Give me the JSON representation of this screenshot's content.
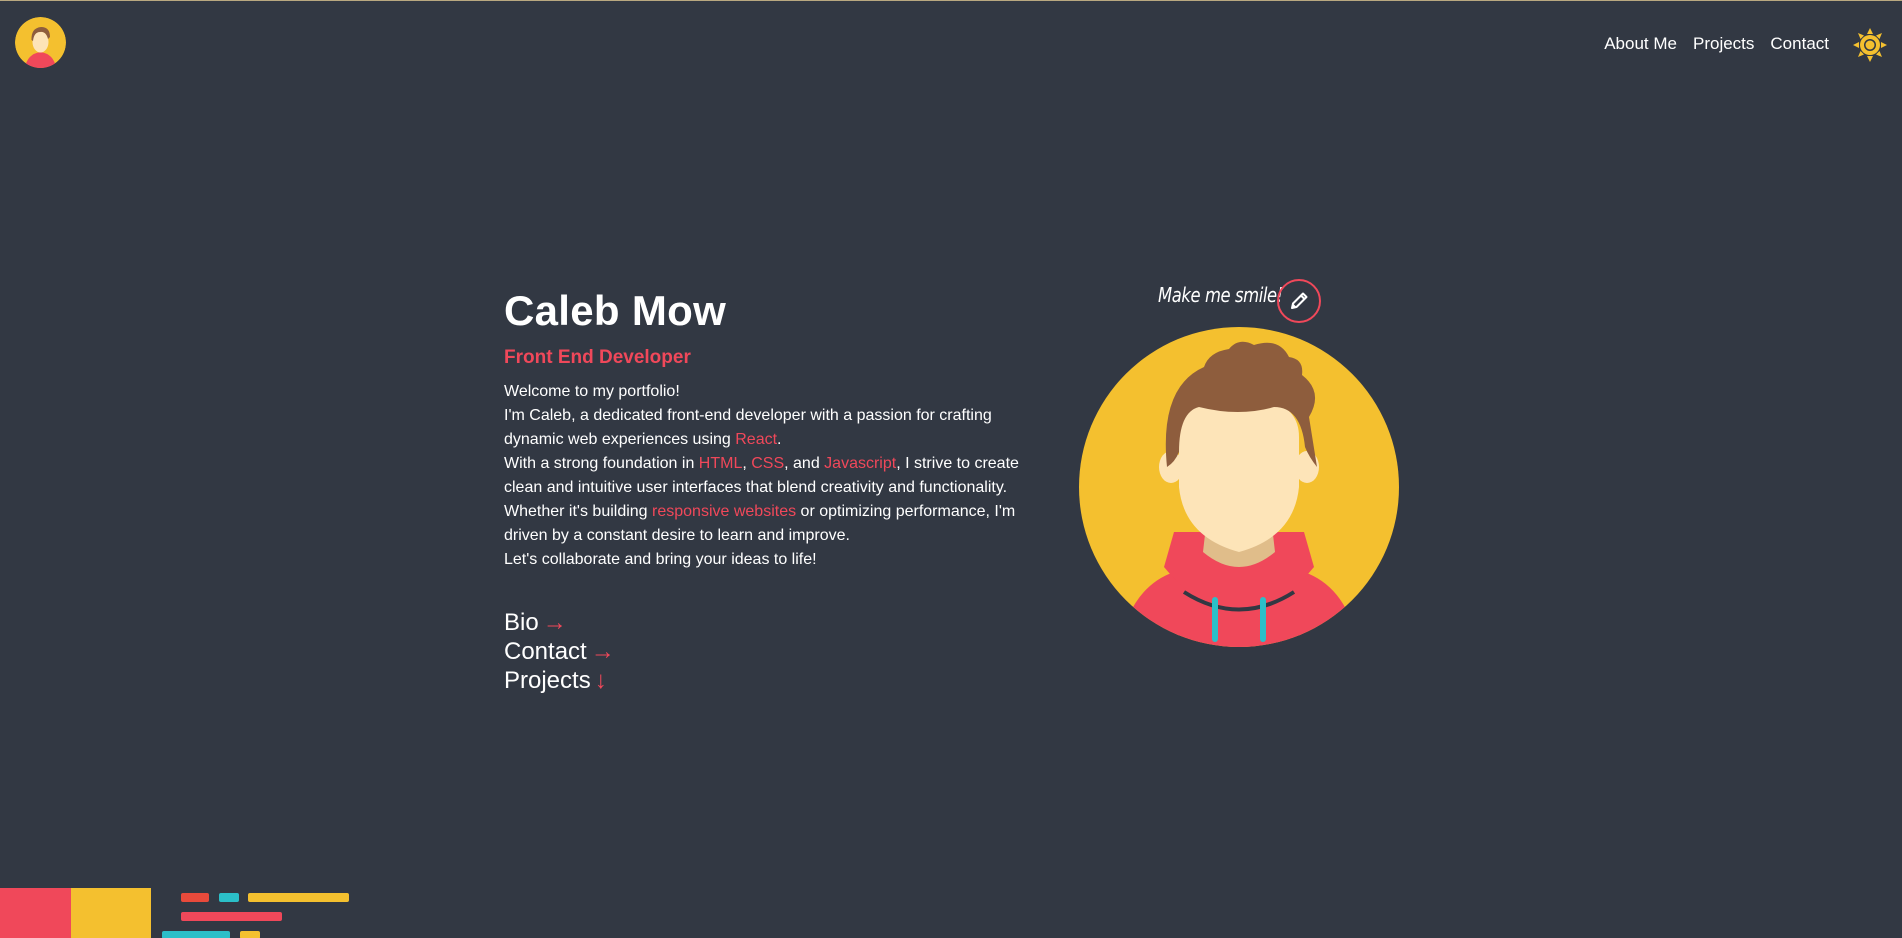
{
  "header": {
    "nav": [
      {
        "label": "About Me"
      },
      {
        "label": "Projects"
      },
      {
        "label": "Contact"
      }
    ]
  },
  "intro": {
    "name": "Caleb Mow",
    "role": "Front End Developer",
    "bio": {
      "line1": "Welcome to my portfolio!",
      "line2_pre": "I'm Caleb, a dedicated front-end developer with a passion for crafting dynamic web experiences using ",
      "line2_hl": "React",
      "line2_post": ".",
      "line3_pre": "With a strong foundation in ",
      "line3_hl1": "HTML",
      "line3_sep1": ", ",
      "line3_hl2": "CSS",
      "line3_sep2": ", and ",
      "line3_hl3": "Javascript",
      "line3_post": ", I strive to create clean and intuitive user interfaces that blend creativity and functionality.",
      "line4_pre": "Whether it's building ",
      "line4_hl": "responsive websites",
      "line4_post": " or optimizing performance, I'm driven by a constant desire to learn and improve.",
      "line5": "Let's collaborate and bring your ideas to life!"
    },
    "links": [
      {
        "label": "Bio",
        "arrow": "→"
      },
      {
        "label": "Contact",
        "arrow": "→"
      },
      {
        "label": "Projects",
        "arrow": "↓"
      }
    ]
  },
  "avatar": {
    "prompt": "Make me smile!"
  },
  "colors": {
    "background": "#323843",
    "accent": "#f0485a",
    "yellow": "#f4c02f",
    "teal": "#2bbfc8"
  },
  "icons": {
    "logo": "avatar-logo-icon",
    "theme": "sun-icon",
    "edit": "pencil-icon"
  }
}
